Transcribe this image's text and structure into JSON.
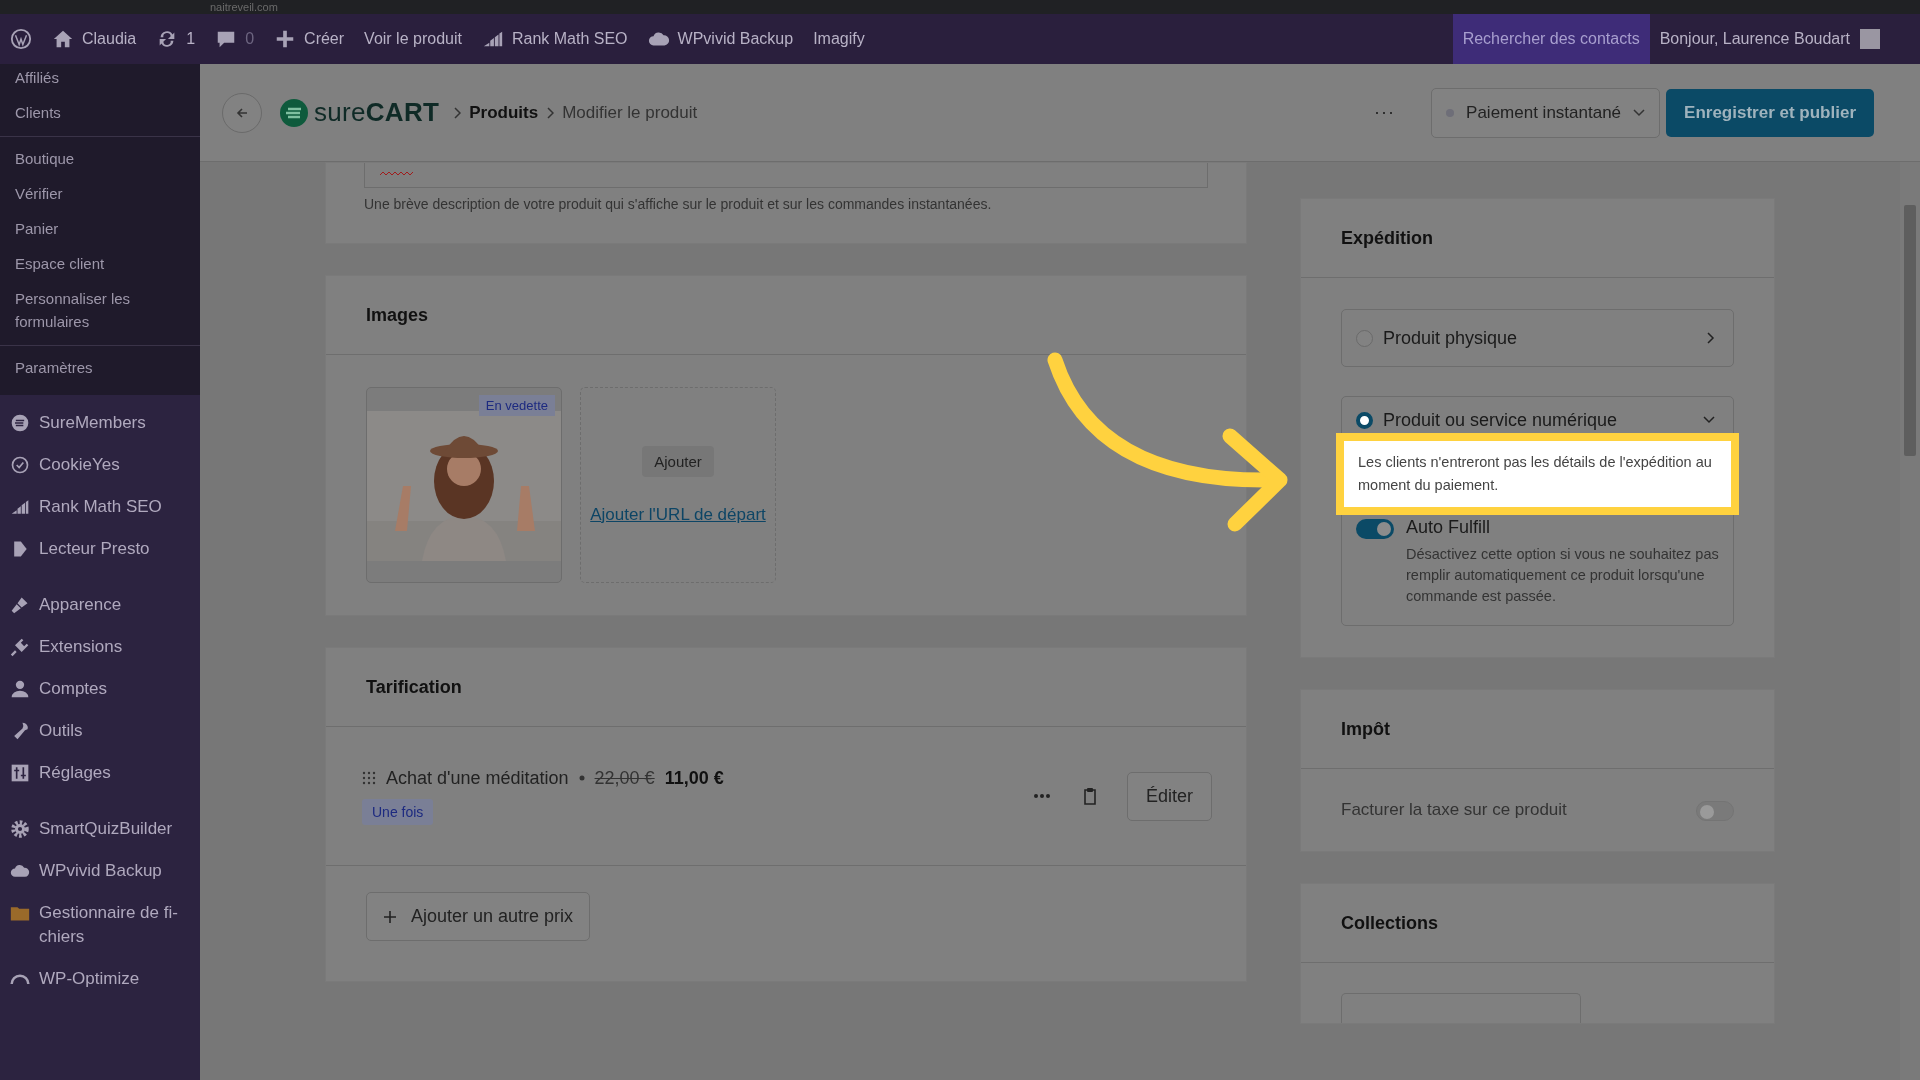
{
  "browser": {
    "url": "naitreveil.com"
  },
  "admin_bar": {
    "items": [
      {
        "kind": "logo"
      },
      {
        "kind": "home",
        "label": "Claudia"
      },
      {
        "kind": "updates",
        "label": "1"
      },
      {
        "kind": "comments",
        "label": "0"
      },
      {
        "kind": "new",
        "label": "Créer"
      },
      {
        "kind": "text",
        "label": "Voir le produit"
      },
      {
        "kind": "chart",
        "label": "Rank Math SEO"
      },
      {
        "kind": "cloud",
        "label": "WPvivid Backup"
      },
      {
        "kind": "text",
        "label": "Imagify"
      }
    ],
    "search": "Rechercher des contacts",
    "greeting": "Bonjour, Laurence Boudart"
  },
  "sidebar": {
    "submenu": [
      [
        "Affiliés",
        "Clients"
      ],
      [
        "Boutique",
        "Vérifier",
        "Panier",
        "Espace client",
        "Personnaliser les formulaires"
      ],
      [
        "Paramètres"
      ]
    ],
    "menu": [
      [
        {
          "kind": "lines",
          "label": "SureMembers"
        },
        {
          "kind": "cookie",
          "label": "CookieYes"
        },
        {
          "kind": "chart",
          "label": "Rank Math SEO"
        },
        {
          "kind": "play",
          "label": "Lecteur Presto"
        }
      ],
      [
        {
          "kind": "brush",
          "label": "Apparence"
        },
        {
          "kind": "plug",
          "label": "Extensions"
        },
        {
          "kind": "user",
          "label": "Comptes"
        },
        {
          "kind": "wrench",
          "label": "Outils"
        },
        {
          "kind": "sliders",
          "label": "Réglages"
        }
      ],
      [
        {
          "kind": "gear",
          "label": "SmartQuizBuilder"
        },
        {
          "kind": "cloud",
          "label": "WPvivid Backup"
        },
        {
          "kind": "folder",
          "label": "Gestionnaire de fi-\nchiers"
        },
        {
          "kind": "gauge",
          "label": "WP-Optimize"
        }
      ]
    ]
  },
  "header": {
    "logo": "sure**CART**",
    "breadcrumb": [
      {
        "label": "Produits",
        "current": false
      },
      {
        "label": "Modifier le produit",
        "current": true
      }
    ],
    "more": "···",
    "status": "Paiement instantané",
    "publish": "Enregistrer et publier"
  },
  "description": {
    "hint": "Une brève description de votre produit qui s'affiche sur le produit et sur les commandes instantanées."
  },
  "images": {
    "title": "Images",
    "badge": "En vedette",
    "add": "Ajouter",
    "url_link": "Ajouter l'URL de départ"
  },
  "pricing": {
    "title": "Tarification",
    "prices": [
      {
        "name": "Achat d'une méditation",
        "old_price": "22,00 €",
        "price": "11,00 €",
        "tag": "Une fois",
        "edit": "Éditer"
      }
    ],
    "add": "Ajouter un autre prix"
  },
  "shipping": {
    "title": "Expédition",
    "options": [
      {
        "label": "Produit physique",
        "selected": false,
        "expanded": false
      },
      {
        "label": "Produit ou service numérique",
        "selected": true,
        "expanded": true
      }
    ],
    "note": "Les clients n'entreront pas les détails de l'expédition au moment du paiement.",
    "auto_fulfill": {
      "label": "Auto Fulfill",
      "description": "Désactivez cette option si vous ne souhaitez pas remplir automatiquement ce produit lorsqu'une commande est passée.",
      "on": true
    }
  },
  "tax": {
    "title": "Impôt",
    "label": "Facturer la taxe sur ce produit",
    "on": false
  },
  "collections": {
    "title": "Collections"
  }
}
